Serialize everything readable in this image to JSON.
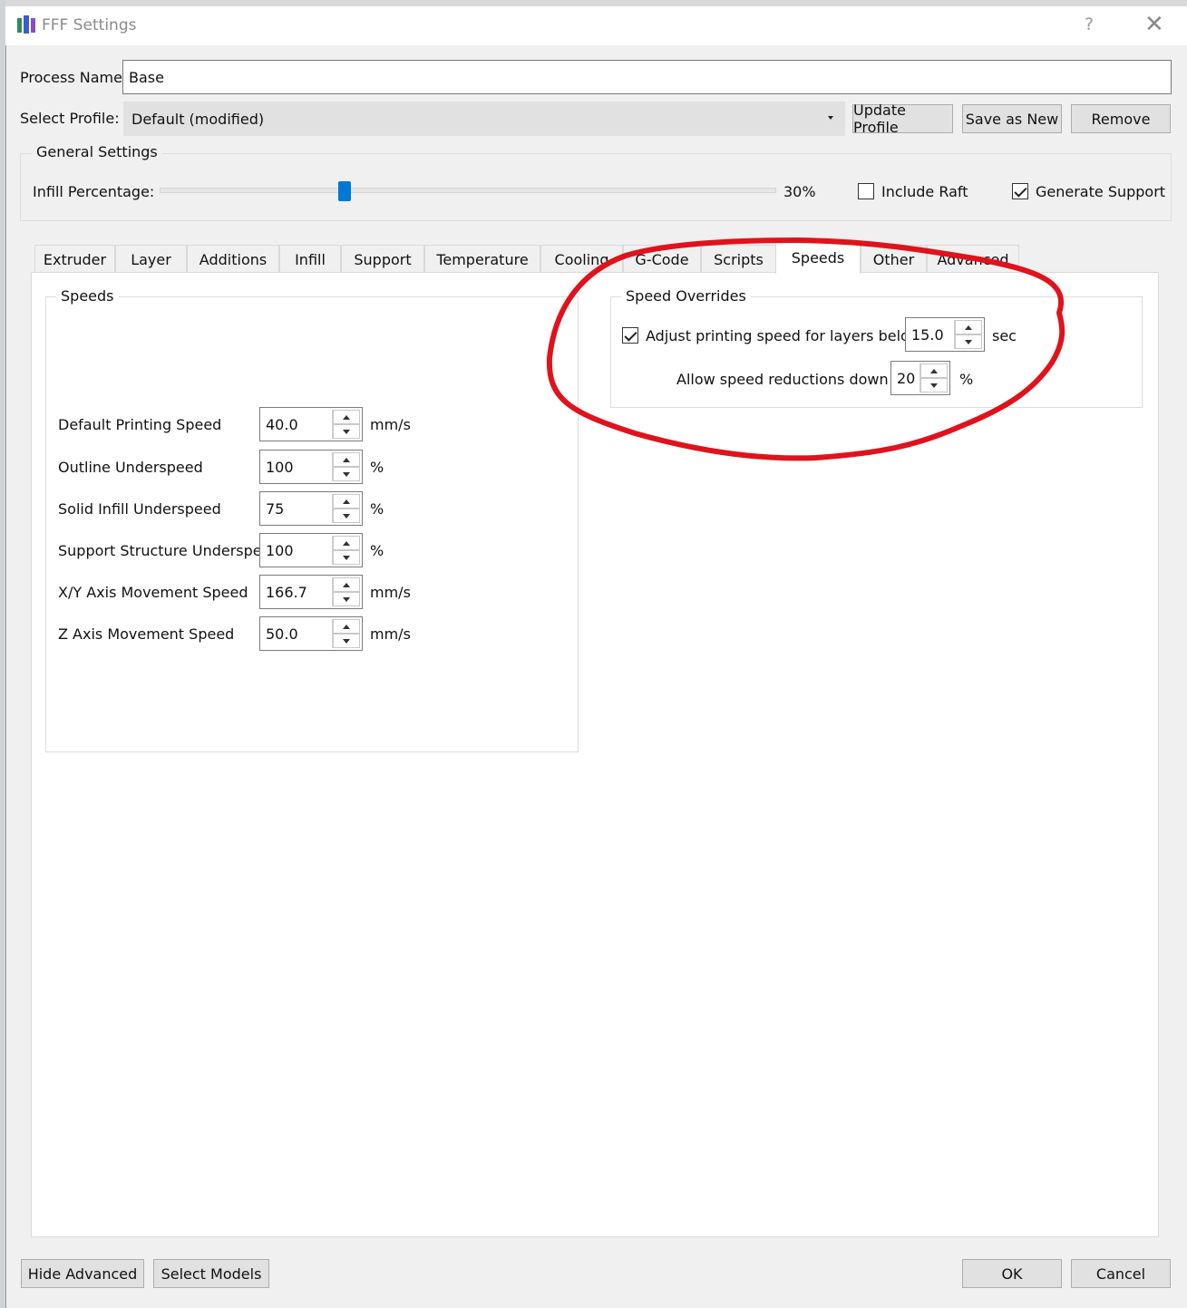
{
  "window": {
    "title": "FFF Settings",
    "help_glyph": "?",
    "close_glyph": "✕"
  },
  "process": {
    "label": "Process Name:",
    "value": "Base"
  },
  "profile": {
    "label": "Select Profile:",
    "selected": "Default (modified)",
    "update_label": "Update Profile",
    "save_new_label": "Save as New",
    "remove_label": "Remove"
  },
  "general": {
    "title": "General Settings",
    "infill_label": "Infill Percentage:",
    "infill_value": "30%",
    "infill_fraction": 0.3,
    "include_raft_label": "Include Raft",
    "include_raft_checked": false,
    "generate_support_label": "Generate Support",
    "generate_support_checked": true
  },
  "tabs": [
    {
      "label": "Extruder"
    },
    {
      "label": "Layer"
    },
    {
      "label": "Additions"
    },
    {
      "label": "Infill"
    },
    {
      "label": "Support"
    },
    {
      "label": "Temperature"
    },
    {
      "label": "Cooling"
    },
    {
      "label": "G-Code"
    },
    {
      "label": "Scripts"
    },
    {
      "label": "Speeds",
      "active": true
    },
    {
      "label": "Other"
    },
    {
      "label": "Advanced"
    }
  ],
  "speeds": {
    "title": "Speeds",
    "rows": [
      {
        "label": "Default Printing Speed",
        "value": "40.0",
        "unit": "mm/s"
      },
      {
        "label": "Outline Underspeed",
        "value": "100",
        "unit": "%"
      },
      {
        "label": "Solid Infill Underspeed",
        "value": "75",
        "unit": "%"
      },
      {
        "label": "Support Structure Underspeed",
        "value": "100",
        "unit": "%"
      },
      {
        "label": "X/Y Axis Movement Speed",
        "value": "166.7",
        "unit": "mm/s"
      },
      {
        "label": "Z Axis Movement Speed",
        "value": "50.0",
        "unit": "mm/s"
      }
    ]
  },
  "overrides": {
    "title": "Speed Overrides",
    "adjust_label": "Adjust printing speed for layers below",
    "adjust_checked": true,
    "adjust_value": "15.0",
    "adjust_unit": "sec",
    "reduce_label": "Allow speed reductions down to",
    "reduce_value": "20",
    "reduce_unit": "%"
  },
  "footer": {
    "hide_advanced_label": "Hide Advanced",
    "select_models_label": "Select Models",
    "ok_label": "OK",
    "cancel_label": "Cancel"
  },
  "annotation_color": "#e0121b"
}
